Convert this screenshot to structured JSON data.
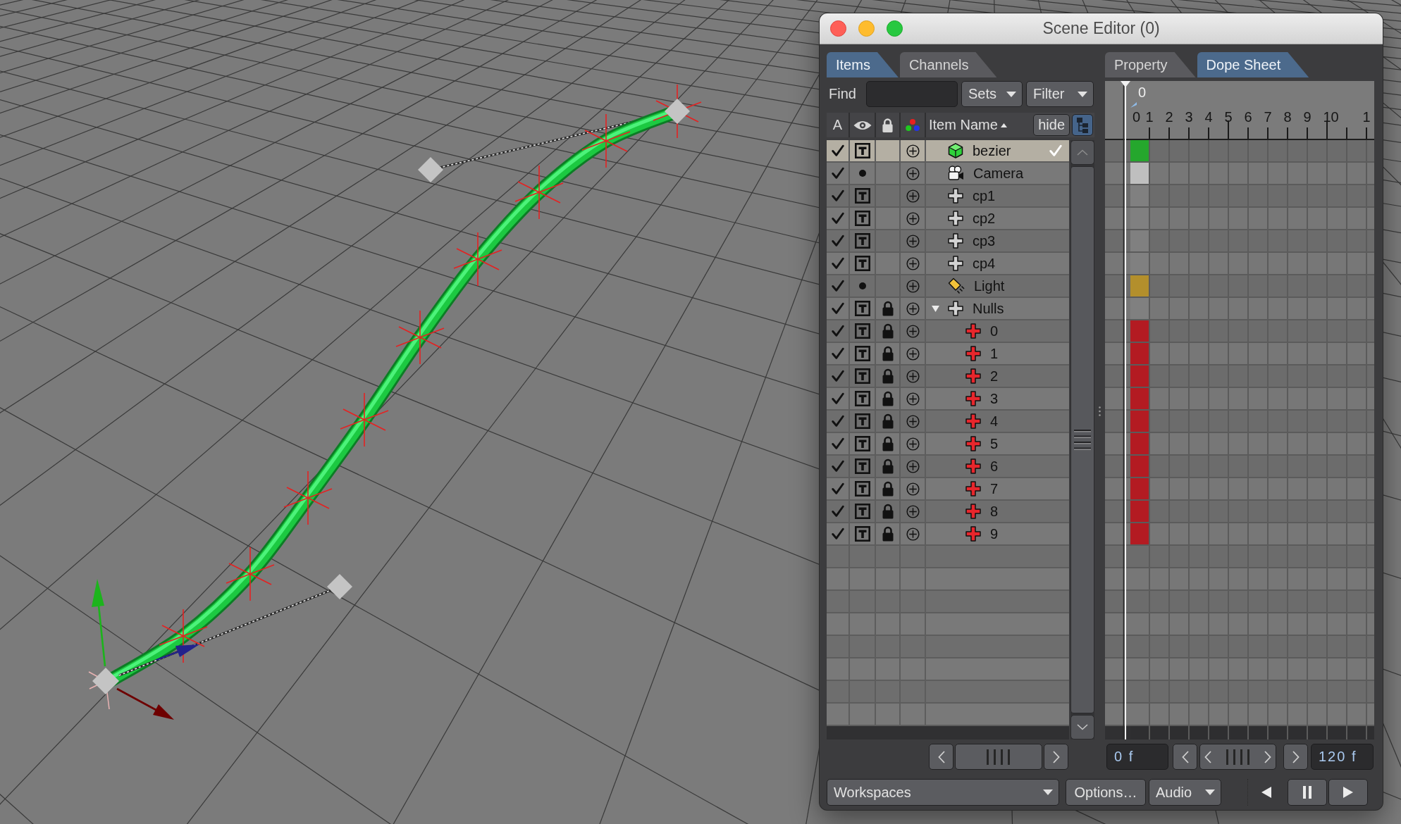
{
  "window": {
    "title": "Scene Editor (0)"
  },
  "left_tabs": [
    {
      "label": "Items",
      "selected": true
    },
    {
      "label": "Channels",
      "selected": false
    }
  ],
  "find": {
    "label": "Find"
  },
  "sets_menu": {
    "label": "Sets"
  },
  "filter_menu": {
    "label": "Filter"
  },
  "list_header": {
    "active": "A",
    "name": "Item Name",
    "sort_ascending": true,
    "hide": "hide",
    "tree_view": true
  },
  "items": [
    {
      "name": "bezier",
      "kind": "mesh",
      "active": true,
      "textured": true,
      "locked": false,
      "selected": true,
      "expanded": false,
      "color": "#25a72d"
    },
    {
      "name": "Camera",
      "kind": "camera",
      "active": true,
      "textured": false,
      "locked": false,
      "selected": false,
      "expanded": false,
      "color": "#bfbfbf"
    },
    {
      "name": "cp1",
      "kind": "null",
      "active": true,
      "textured": true,
      "locked": false,
      "selected": false,
      "expanded": false,
      "color": "#808080"
    },
    {
      "name": "cp2",
      "kind": "null",
      "active": true,
      "textured": true,
      "locked": false,
      "selected": false,
      "expanded": false,
      "color": "#808080"
    },
    {
      "name": "cp3",
      "kind": "null",
      "active": true,
      "textured": true,
      "locked": false,
      "selected": false,
      "expanded": false,
      "color": "#808080"
    },
    {
      "name": "cp4",
      "kind": "null",
      "active": true,
      "textured": true,
      "locked": false,
      "selected": false,
      "expanded": false,
      "color": "#808080"
    },
    {
      "name": "Light",
      "kind": "light",
      "active": true,
      "textured": false,
      "locked": false,
      "selected": false,
      "expanded": false,
      "color": "#b38f2c"
    },
    {
      "name": "Nulls",
      "kind": "null",
      "active": true,
      "textured": true,
      "locked": true,
      "selected": false,
      "expanded": true,
      "color": "#808080",
      "children": [
        {
          "name": "0",
          "kind": "locator",
          "active": true,
          "textured": true,
          "locked": true,
          "selected": false,
          "color": "#b31b22"
        },
        {
          "name": "1",
          "kind": "locator",
          "active": true,
          "textured": true,
          "locked": true,
          "selected": false,
          "color": "#b31b22"
        },
        {
          "name": "2",
          "kind": "locator",
          "active": true,
          "textured": true,
          "locked": true,
          "selected": false,
          "color": "#b31b22"
        },
        {
          "name": "3",
          "kind": "locator",
          "active": true,
          "textured": true,
          "locked": true,
          "selected": false,
          "color": "#b31b22"
        },
        {
          "name": "4",
          "kind": "locator",
          "active": true,
          "textured": true,
          "locked": true,
          "selected": false,
          "color": "#b31b22"
        },
        {
          "name": "5",
          "kind": "locator",
          "active": true,
          "textured": true,
          "locked": true,
          "selected": false,
          "color": "#b31b22"
        },
        {
          "name": "6",
          "kind": "locator",
          "active": true,
          "textured": true,
          "locked": true,
          "selected": false,
          "color": "#b31b22"
        },
        {
          "name": "7",
          "kind": "locator",
          "active": true,
          "textured": true,
          "locked": true,
          "selected": false,
          "color": "#b31b22"
        },
        {
          "name": "8",
          "kind": "locator",
          "active": true,
          "textured": true,
          "locked": true,
          "selected": false,
          "color": "#b31b22"
        },
        {
          "name": "9",
          "kind": "locator",
          "active": true,
          "textured": true,
          "locked": true,
          "selected": false,
          "color": "#b31b22"
        }
      ]
    }
  ],
  "right_tabs": [
    {
      "label": "Property",
      "selected": false
    },
    {
      "label": "Dope Sheet",
      "selected": true
    }
  ],
  "dope_sheet": {
    "current_frame": "0",
    "frame_labels": [
      "0",
      "1",
      "2",
      "3",
      "4",
      "5",
      "6",
      "7",
      "8",
      "9",
      "10",
      "1"
    ]
  },
  "time_range": {
    "start": "0 f",
    "end": "120 f"
  },
  "bottom_bar": {
    "workspaces": "Workspaces",
    "options": "Options…",
    "audio": "Audio"
  }
}
